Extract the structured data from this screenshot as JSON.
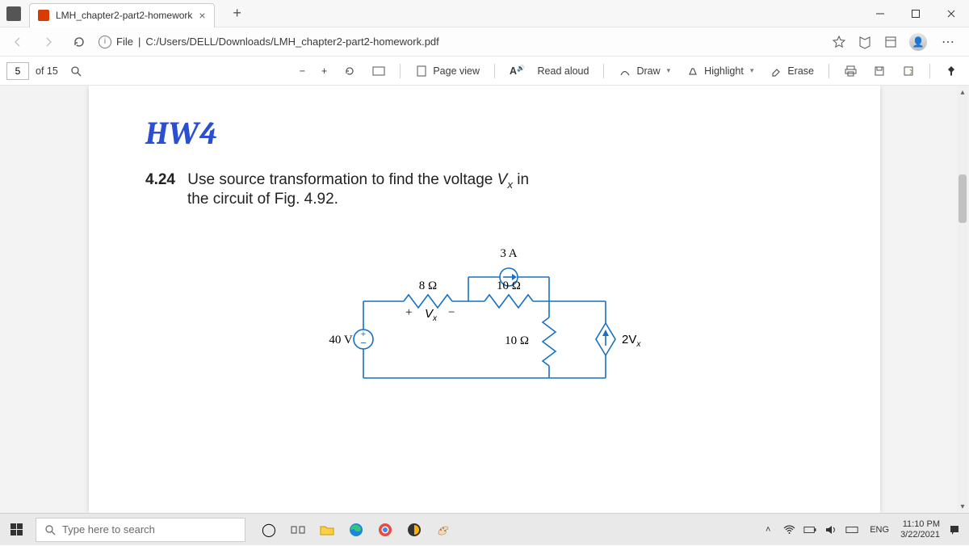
{
  "tab": {
    "title": "LMH_chapter2-part2-homework"
  },
  "addr": {
    "scheme": "File",
    "path": "C:/Users/DELL/Downloads/LMH_chapter2-part2-homework.pdf"
  },
  "pdf": {
    "page_current": "5",
    "page_of_label": "of 15",
    "page_view": "Page view",
    "read_aloud": "Read aloud",
    "draw": "Draw",
    "highlight": "Highlight",
    "erase": "Erase"
  },
  "doc": {
    "hw_title": "HW4",
    "problem_num": "4.24",
    "problem_l1a": "Use source transformation to find the voltage ",
    "problem_l1b": " in",
    "problem_l2": "the circuit of Fig. 4.92.",
    "vx": "V",
    "vx_sub": "x"
  },
  "circuit": {
    "i_src": "3 A",
    "r_top_left": "8 Ω",
    "r_top_right": "10 Ω",
    "r_mid": "10 Ω",
    "v_src": "40 V",
    "vx_label_plus": "+",
    "vx_label": "V",
    "vx_label_sub": "x",
    "vx_label_minus": "−",
    "dep_src": "2V",
    "dep_src_sub": "x"
  },
  "taskbar": {
    "search_placeholder": "Type here to search",
    "lang": "ENG",
    "time": "11:10 PM",
    "date": "3/22/2021"
  }
}
